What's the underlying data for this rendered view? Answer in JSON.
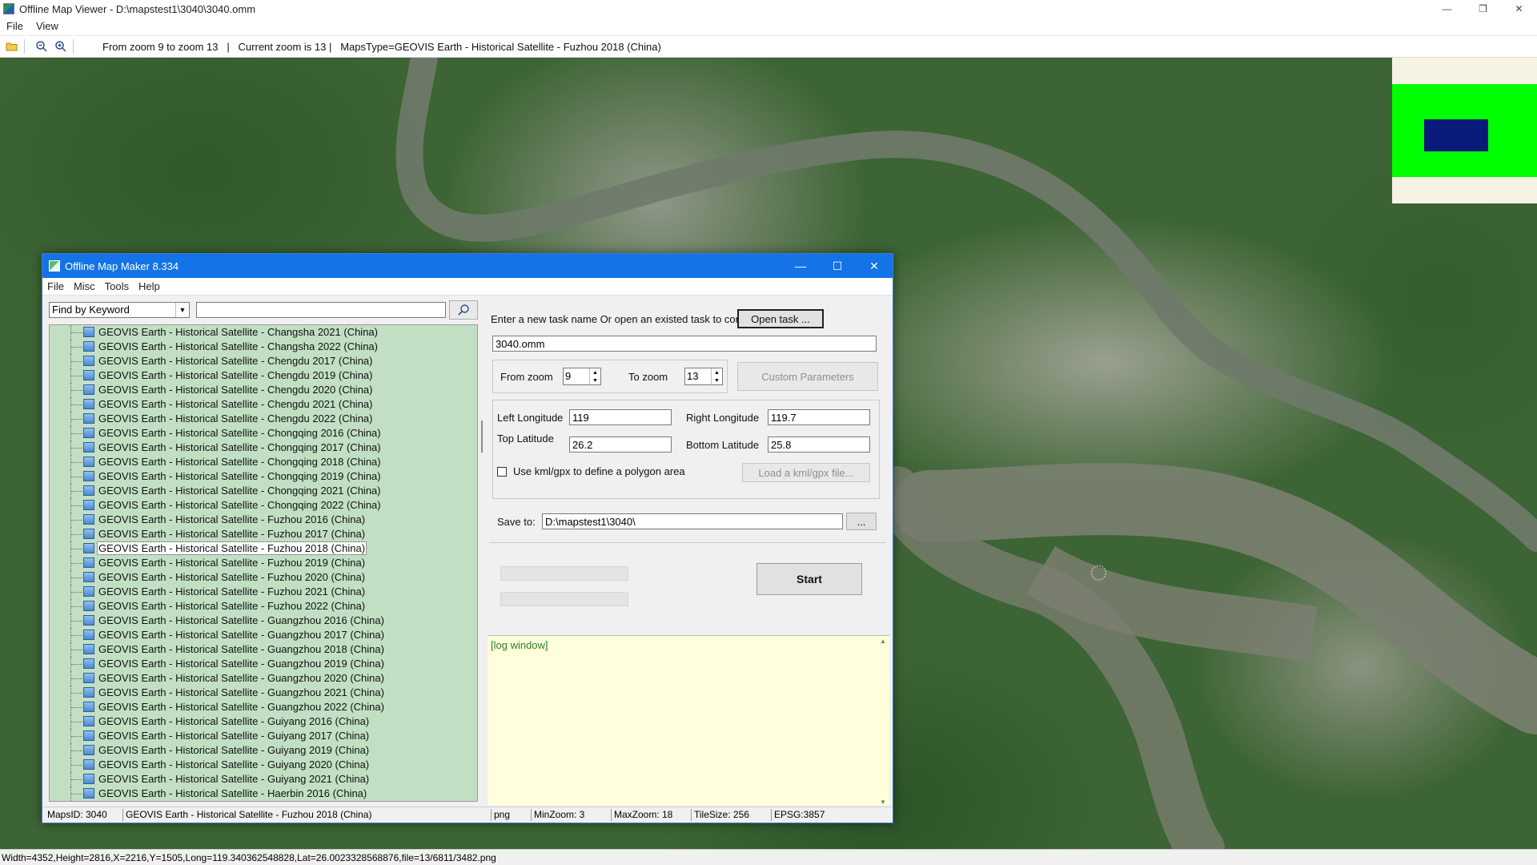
{
  "viewer": {
    "title": "Offline Map Viewer - D:\\mapstest1\\3040\\3040.omm",
    "menu": [
      "File",
      "View"
    ],
    "toolbar_info": "From zoom 9 to zoom 13   |   Current zoom is 13 |   MapsType=GEOVIS Earth - Historical Satellite - Fuzhou 2018 (China)",
    "status": "Width=4352,Height=2816,X=2216,Y=1505,Long=119.340362548828,Lat=26.0023328568876,file=13/6811/3482.png",
    "colors": {
      "minimap_bg": "#f6f3e5",
      "minimap_green": "#00ff00",
      "minimap_view": "#0a1a7a"
    },
    "icons": [
      "app-icon",
      "open-folder-icon",
      "zoom-out-icon",
      "zoom-in-icon",
      "minimize-icon",
      "restore-icon",
      "close-icon"
    ]
  },
  "dialog": {
    "title": "Offline Map Maker 8.334",
    "menu": [
      "File",
      "Misc",
      "Tools",
      "Help"
    ],
    "search": {
      "mode": "Find by Keyword",
      "query": ""
    },
    "tree_items": [
      "GEOVIS Earth - Historical Satellite - Changsha 2021 (China)",
      "GEOVIS Earth - Historical Satellite - Changsha 2022 (China)",
      "GEOVIS Earth - Historical Satellite - Chengdu 2017 (China)",
      "GEOVIS Earth - Historical Satellite - Chengdu 2019 (China)",
      "GEOVIS Earth - Historical Satellite - Chengdu 2020 (China)",
      "GEOVIS Earth - Historical Satellite - Chengdu 2021 (China)",
      "GEOVIS Earth - Historical Satellite - Chengdu 2022 (China)",
      "GEOVIS Earth - Historical Satellite - Chongqing 2016 (China)",
      "GEOVIS Earth - Historical Satellite - Chongqing 2017 (China)",
      "GEOVIS Earth - Historical Satellite - Chongqing 2018 (China)",
      "GEOVIS Earth - Historical Satellite - Chongqing 2019 (China)",
      "GEOVIS Earth - Historical Satellite - Chongqing 2021 (China)",
      "GEOVIS Earth - Historical Satellite - Chongqing 2022 (China)",
      "GEOVIS Earth - Historical Satellite - Fuzhou 2016 (China)",
      "GEOVIS Earth - Historical Satellite - Fuzhou 2017 (China)",
      "GEOVIS Earth - Historical Satellite - Fuzhou 2018 (China)",
      "GEOVIS Earth - Historical Satellite - Fuzhou 2019 (China)",
      "GEOVIS Earth - Historical Satellite - Fuzhou 2020 (China)",
      "GEOVIS Earth - Historical Satellite - Fuzhou 2021 (China)",
      "GEOVIS Earth - Historical Satellite - Fuzhou 2022 (China)",
      "GEOVIS Earth - Historical Satellite - Guangzhou 2016 (China)",
      "GEOVIS Earth - Historical Satellite - Guangzhou 2017 (China)",
      "GEOVIS Earth - Historical Satellite - Guangzhou 2018 (China)",
      "GEOVIS Earth - Historical Satellite - Guangzhou 2019 (China)",
      "GEOVIS Earth - Historical Satellite - Guangzhou 2020 (China)",
      "GEOVIS Earth - Historical Satellite - Guangzhou 2021 (China)",
      "GEOVIS Earth - Historical Satellite - Guangzhou 2022 (China)",
      "GEOVIS Earth - Historical Satellite - Guiyang 2016 (China)",
      "GEOVIS Earth - Historical Satellite - Guiyang 2017 (China)",
      "GEOVIS Earth - Historical Satellite - Guiyang 2019 (China)",
      "GEOVIS Earth - Historical Satellite - Guiyang 2020 (China)",
      "GEOVIS Earth - Historical Satellite - Guiyang 2021 (China)",
      "GEOVIS Earth - Historical Satellite - Haerbin 2016 (China)"
    ],
    "selected_index": 15,
    "task": {
      "prompt": "Enter a new task name Or open an existed task to continue:",
      "open_btn": "Open task ...",
      "name": "3040.omm"
    },
    "zoom": {
      "from_label": "From zoom",
      "from_value": "9",
      "to_label": "To zoom",
      "to_value": "13",
      "custom_btn": "Custom Parameters"
    },
    "coords": {
      "left_lon_label": "Left Longitude",
      "left_lon": "119",
      "right_lon_label": "Right Longitude",
      "right_lon": "119.7",
      "top_lat_label": "Top Latitude",
      "top_lat": "26.2",
      "bottom_lat_label": "Bottom Latitude",
      "bottom_lat": "25.8",
      "kml_checkbox_label": "Use kml/gpx to define a polygon area",
      "kml_checked": false,
      "kml_btn": "Load a kml/gpx file..."
    },
    "save": {
      "label": "Save to:",
      "path": "D:\\mapstest1\\3040\\",
      "browse_btn": "..."
    },
    "start_btn": "Start",
    "log": "[log window]",
    "status": {
      "maps_id": "MapsID: 3040",
      "maps_name": "GEOVIS Earth - Historical Satellite - Fuzhou 2018 (China)",
      "format": "png",
      "min_zoom": "MinZoom: 3",
      "max_zoom": "MaxZoom: 18",
      "tile_size": "TileSize: 256",
      "epsg": "EPSG:3857"
    }
  }
}
